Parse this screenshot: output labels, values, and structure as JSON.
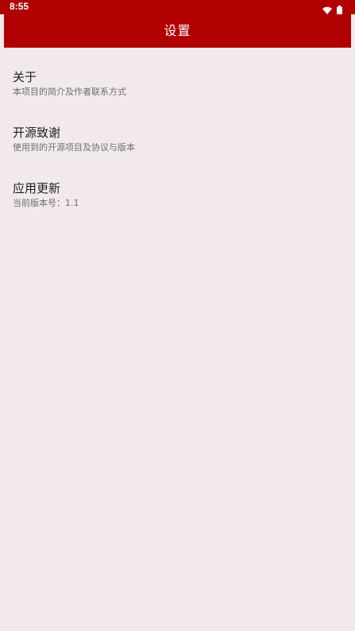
{
  "status_bar": {
    "time": "8:55",
    "icons": [
      "wifi-icon",
      "battery-icon"
    ]
  },
  "app_bar": {
    "title": "设置"
  },
  "settings": {
    "items": [
      {
        "title": "关于",
        "subtitle": "本项目的简介及作者联系方式"
      },
      {
        "title": "开源致谢",
        "subtitle": "使用到的开源项目及协议与版本"
      },
      {
        "title": "应用更新",
        "subtitle": "当前版本号：1.1"
      }
    ]
  },
  "colors": {
    "primary": "#b00000",
    "background": "#f2e9ea",
    "title_text": "#1f1f1f",
    "subtitle_text": "#6f6f6f"
  }
}
